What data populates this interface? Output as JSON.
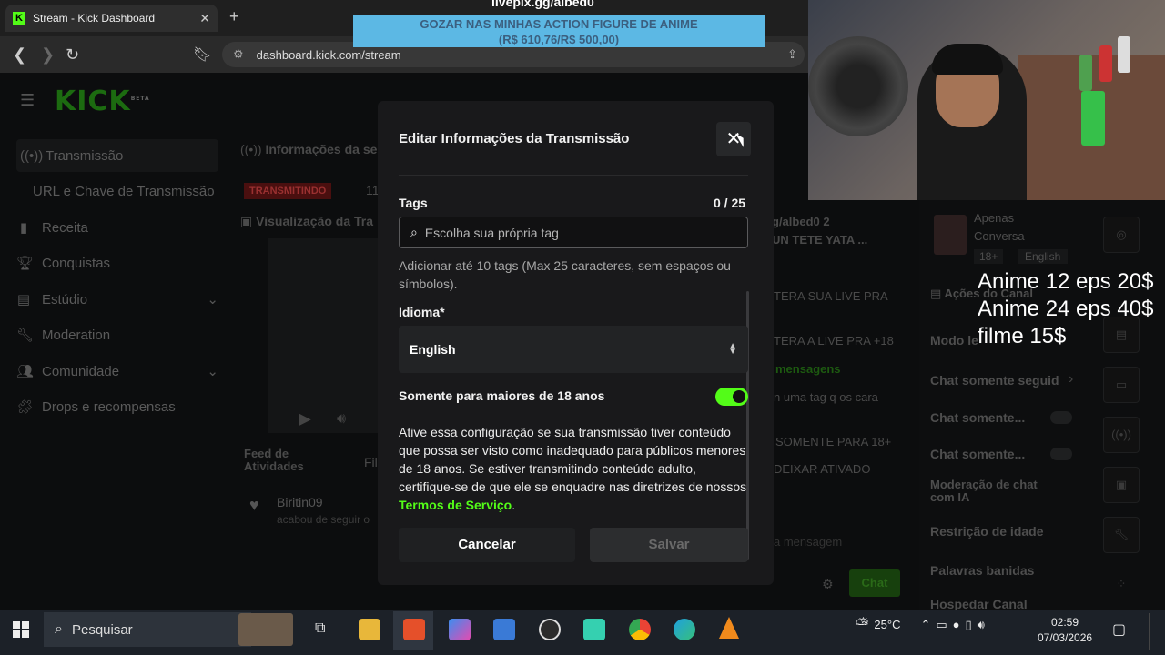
{
  "browser": {
    "tab_title": "Stream - Kick Dashboard",
    "url": "dashboard.kick.com/stream"
  },
  "overlay": {
    "top_text": "livepix.gg/albed0",
    "banner_line1": "GOZAR NAS MINHAS ACTION FIGURE DE ANIME",
    "banner_line2": "(R$ 610,76/R$ 500,00)",
    "promo": [
      "Anime 12 eps 20$",
      "Anime 24 eps 40$",
      "filme 15$"
    ]
  },
  "sidebar": {
    "logo": "KICK",
    "logo_sup": "BETA",
    "items": [
      {
        "label": "Transmissão",
        "icon": "broadcast-icon"
      },
      {
        "label": "URL e Chave de Transmissão",
        "icon": ""
      },
      {
        "label": "Receita",
        "icon": "chart-icon"
      },
      {
        "label": "Conquistas",
        "icon": "trophy-icon"
      },
      {
        "label": "Estúdio",
        "icon": "studio-icon"
      },
      {
        "label": "Moderation",
        "icon": "wrench-icon"
      },
      {
        "label": "Comunidade",
        "icon": "people-icon"
      },
      {
        "label": "Drops e recompensas",
        "icon": "puzzle-icon"
      }
    ]
  },
  "background": {
    "session_info": "Informações da ses",
    "live_badge": "TRANSMITINDO",
    "live_num": "11",
    "preview_label": "Visualização da Tra",
    "feed_title": "Feed de Atividades",
    "feed_filter": "Fil",
    "feed_user": "Biritin09",
    "feed_action": "acabou de seguir o",
    "chat_lines": [
      "g/albed0 2",
      "UN TETE YATA ...",
      "TERA SUA LIVE PRA",
      "TERA A LIVE PRA +18",
      "mensagens",
      "n uma tag q os cara",
      "SOMENTE PARA 18+",
      "DEIXAR ATIVADO"
    ],
    "chat_placeholder": "a mensagem",
    "chat_button": "Chat"
  },
  "right_panel": {
    "category": "Apenas Conversa",
    "tag1": "18+",
    "tag2": "English",
    "actions_title": "Ações do Canal",
    "items": [
      "Modo le",
      "Chat somente seguid",
      "Chat somente...",
      "Chat somente...",
      "Moderação de chat com IA",
      "Restrição de idade",
      "Palavras banidas",
      "Hospedar Canal"
    ]
  },
  "modal": {
    "title": "Editar Informações da Transmissão",
    "tags_label": "Tags",
    "tags_count": "0 / 25",
    "tags_placeholder": "Escolha sua própria tag",
    "tags_help": "Adicionar até 10 tags (Max 25 caracteres, sem espaços ou símbolos).",
    "language_label": "Idioma*",
    "language_value": "English",
    "adult_label": "Somente para maiores de 18 anos",
    "adult_enabled": true,
    "adult_desc": "Ative essa configuração se sua transmissão tiver conteúdo que possa ser visto como inadequado para públicos menores de 18 anos. Se estiver transmitindo conteúdo adulto, certifique-se de que ele se enquadre nas diretrizes de nossos",
    "tos_link": "Termos de Serviço",
    "tos_end": ".",
    "cancel": "Cancelar",
    "save": "Salvar"
  },
  "taskbar": {
    "search": "Pesquisar",
    "weather": "25°C",
    "time": "02:59",
    "date": "07/03/2026"
  },
  "colors": {
    "accent": "#53fc18",
    "modal_bg": "#19191b"
  }
}
